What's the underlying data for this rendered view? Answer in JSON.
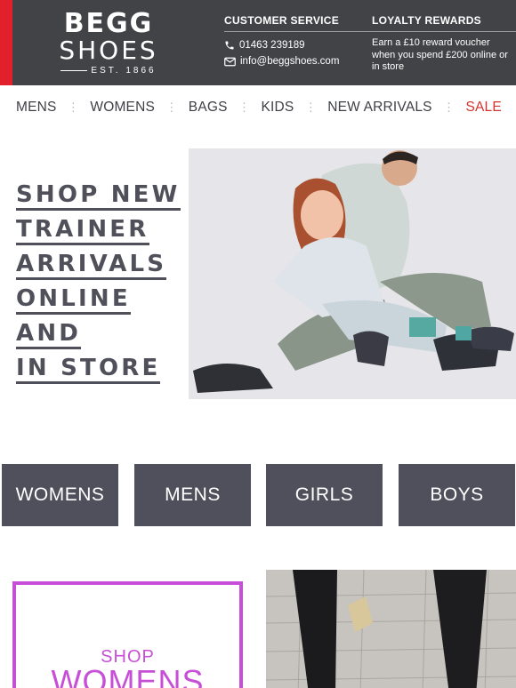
{
  "brand": {
    "line1": "BEGG",
    "line2": "SHOES",
    "established": "EST. 1866"
  },
  "customer_service": {
    "title": "CUSTOMER SERVICE",
    "phone": "01463 239189",
    "email": "info@beggshoes.com"
  },
  "loyalty": {
    "title": "LOYALTY REWARDS",
    "text": "Earn a £10 reward voucher when you spend £200 online or in store"
  },
  "nav": {
    "items": [
      "MENS",
      "WOMENS",
      "BAGS",
      "KIDS",
      "NEW ARRIVALS",
      "SALE"
    ]
  },
  "hero": {
    "lines": [
      "SHOP NEW",
      "TRAINER",
      "ARRIVALS",
      "ONLINE",
      "AND",
      "IN STORE"
    ]
  },
  "categories": [
    "WOMENS",
    "MENS",
    "GIRLS",
    "BOYS"
  ],
  "promo": {
    "shop": "SHOP",
    "womens": "WOMENS"
  },
  "colors": {
    "header_bg": "#424347",
    "accent_red": "#e2202c",
    "sale_red": "#d4322c",
    "tile_bg": "#4f505b",
    "promo_purple": "#c74fd7"
  }
}
